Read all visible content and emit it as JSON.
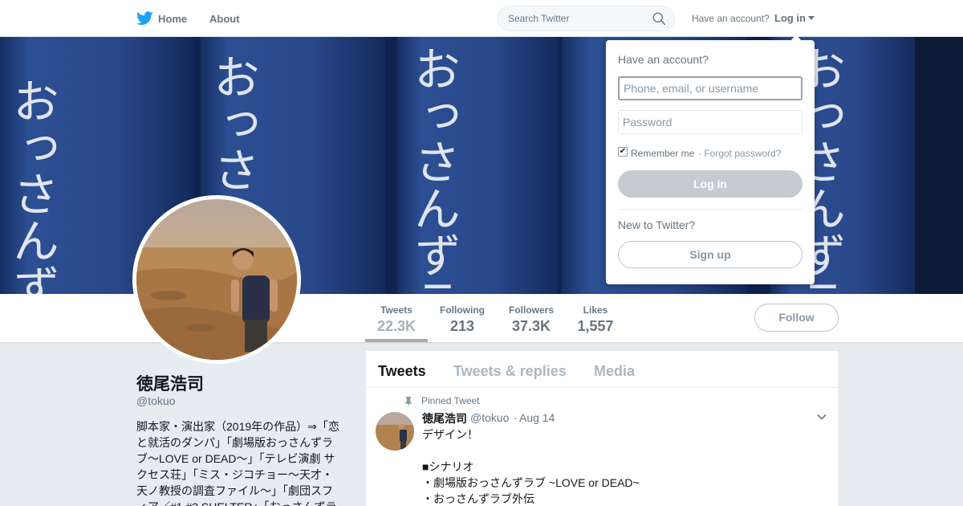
{
  "nav": {
    "home": "Home",
    "about": "About",
    "search_placeholder": "Search Twitter",
    "have_account": "Have an account?",
    "login": "Log in"
  },
  "banner": {
    "text": "おっさんずラブ"
  },
  "stats": [
    {
      "label": "Tweets",
      "value": "22.3K",
      "active": true
    },
    {
      "label": "Following",
      "value": "213"
    },
    {
      "label": "Followers",
      "value": "37.3K"
    },
    {
      "label": "Likes",
      "value": "1,557"
    }
  ],
  "follow_label": "Follow",
  "profile": {
    "name": "徳尾浩司",
    "handle": "@tokuo",
    "bio": "脚本家・演出家（2019年の作品）⇒「恋\nと就活のダンパ」「劇場版おっさんずラ\nブ〜LOVE or DEAD〜」「テレビ演劇 サ\nクセス荘」「ミス・ジコチョー～天才・\n天ノ教授の調査ファイル～」「劇団スフ\nィア／#1 #2 SHELTER」「おっさんずラ"
  },
  "tabs": [
    "Tweets",
    "Tweets & replies",
    "Media"
  ],
  "tweet": {
    "pinned": "Pinned Tweet",
    "name": "徳尾浩司",
    "handle": "@tokuo",
    "separator": "·",
    "date": "Aug 14",
    "text": "デザイン！\n\n■シナリオ\n・劇場版おっさんずラブ ~LOVE or DEAD~\n・おっさんずラブ外伝"
  },
  "login_dropdown": {
    "title": "Have an account?",
    "username_placeholder": "Phone, email, or username",
    "password_placeholder": "Password",
    "remember": "Remember me",
    "forgot": "· Forgot password?",
    "login_button": "Log in",
    "new_to": "New to Twitter?",
    "signup_button": "Sign up"
  },
  "colors": {
    "twitter_blue": "#1da1f2",
    "banner_blue": "#1f3c78"
  }
}
